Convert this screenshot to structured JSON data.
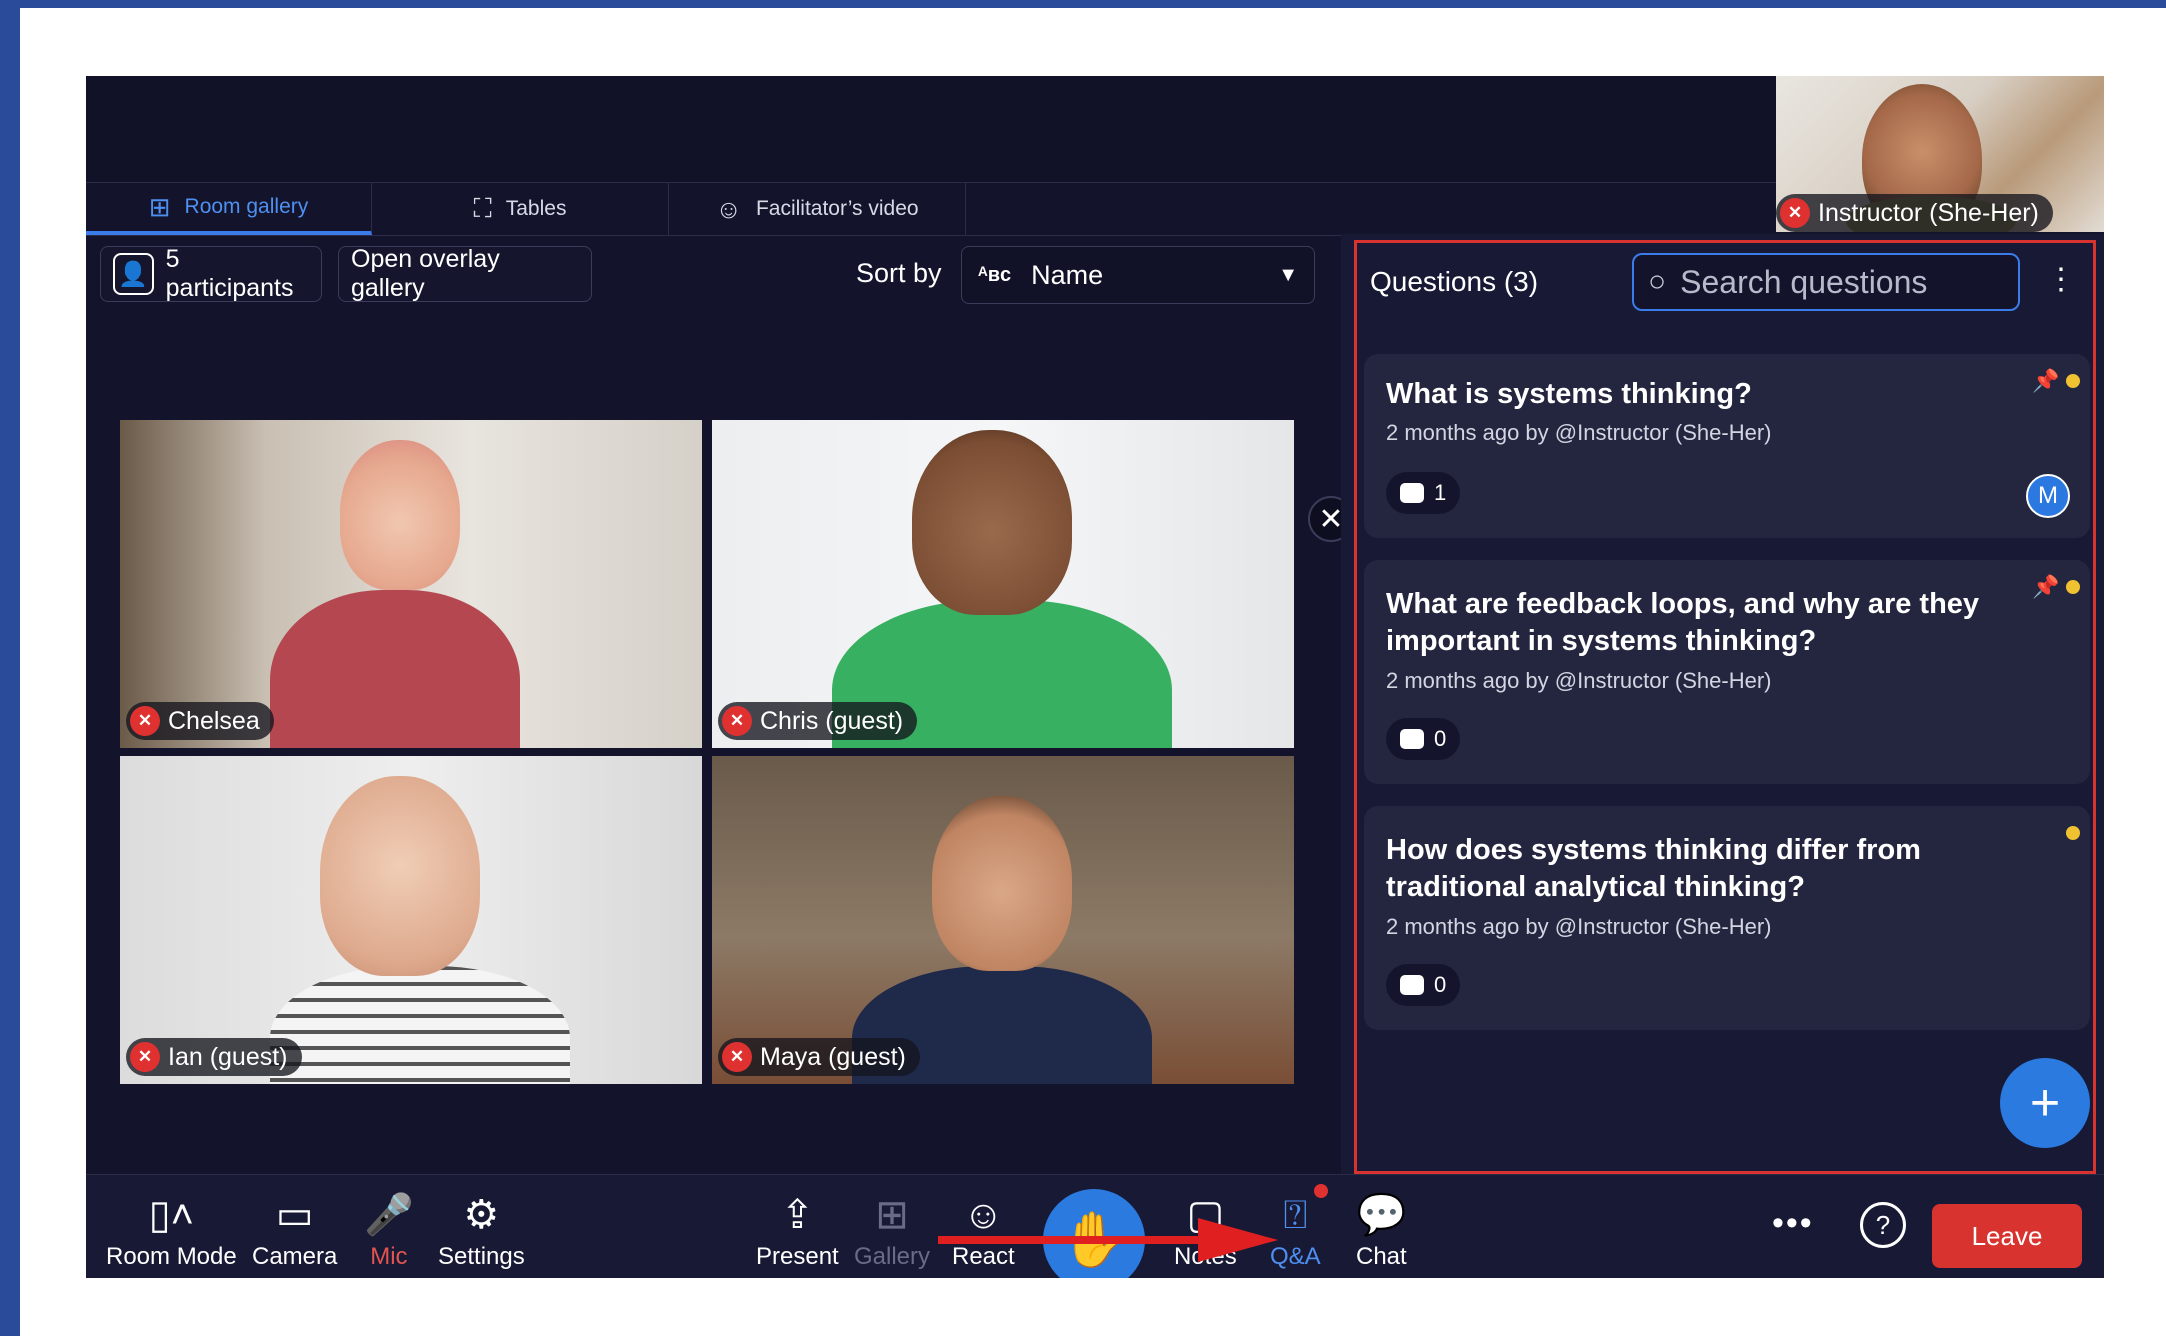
{
  "instructor_video": {
    "name": "Instructor (She-Her)"
  },
  "tabs": [
    {
      "label": "Room gallery",
      "active": true
    },
    {
      "label": "Tables",
      "active": false
    },
    {
      "label": "Facilitator’s video",
      "active": false
    }
  ],
  "toolbar": {
    "participants_label": "5 participants",
    "overlay_label": "Open overlay gallery",
    "sort_by_label": "Sort by",
    "sort_value": "Name"
  },
  "participants": [
    {
      "name": "Chelsea"
    },
    {
      "name": "Chris (guest)"
    },
    {
      "name": "Ian (guest)"
    },
    {
      "name": "Maya (guest)"
    }
  ],
  "qa_panel": {
    "title": "Questions (3)",
    "search_placeholder": "Search questions",
    "questions": [
      {
        "title": "What is systems thinking?",
        "meta": "2 months ago by @Instructor (She-Her)",
        "replies": "1",
        "avatar": "M"
      },
      {
        "title": "What are feedback loops, and why are they important in systems thinking?",
        "meta": "2 months ago by @Instructor (She-Her)",
        "replies": "0"
      },
      {
        "title": "How does systems thinking differ from traditional analytical thinking?",
        "meta": "2 months ago by @Instructor (She-Her)",
        "replies": "0"
      }
    ],
    "accent": "#2a7ae0",
    "highlight_color": "#d8332f"
  },
  "bottom_bar": {
    "room_mode": "Room Mode",
    "camera": "Camera",
    "mic": "Mic",
    "settings": "Settings",
    "present": "Present",
    "gallery": "Gallery",
    "react": "React",
    "notes": "Notes",
    "qa": "Q&A",
    "chat": "Chat",
    "more": "•••",
    "leave": "Leave"
  }
}
